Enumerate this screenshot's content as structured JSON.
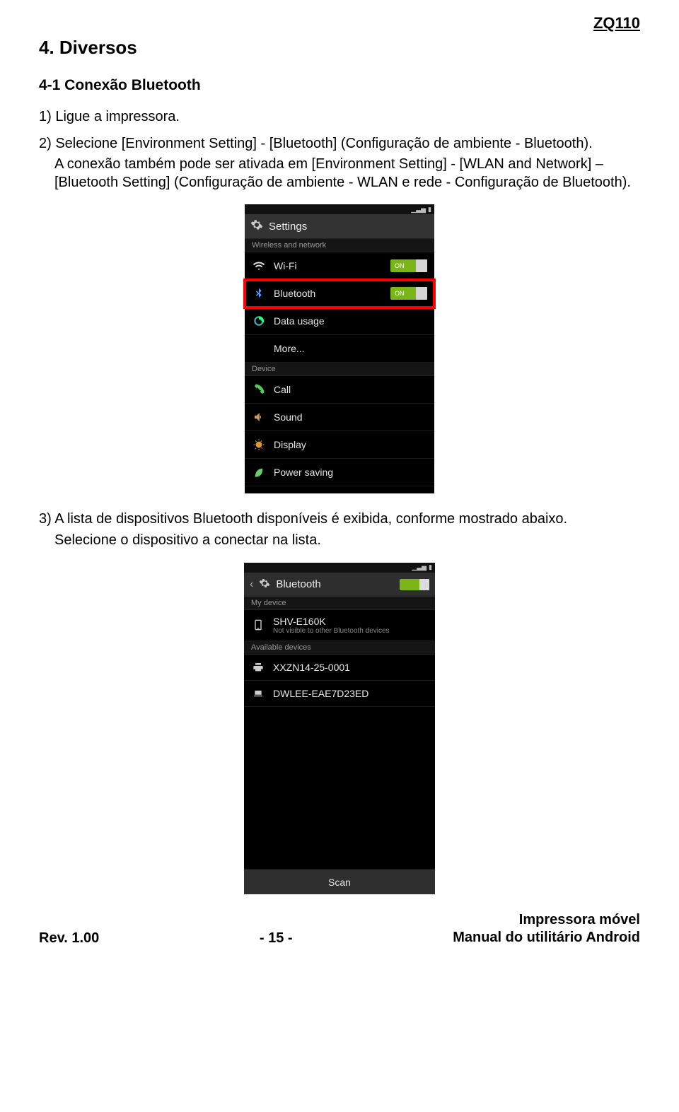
{
  "header_model": "ZQ110",
  "section_title": "4. Diversos",
  "sub_title": "4-1 Conexão Bluetooth",
  "step1": "1) Ligue a impressora.",
  "step2_line1": "2) Selecione [Environment Setting] - [Bluetooth] (Configuração de ambiente - Bluetooth).",
  "step2_line2": "A conexão também pode ser ativada em [Environment Setting] - [WLAN and Network] – [Bluetooth Setting] (Configuração de ambiente - WLAN e rede - Configuração de Bluetooth).",
  "step3_line1": "3) A lista de dispositivos Bluetooth disponíveis é exibida, conforme mostrado abaixo.",
  "step3_line2": "Selecione o dispositivo a conectar na lista.",
  "screenshot1": {
    "title": "Settings",
    "section_wireless": "Wireless and network",
    "items_wireless": [
      {
        "label": "Wi-Fi",
        "toggle": "ON"
      },
      {
        "label": "Bluetooth",
        "toggle": "ON"
      },
      {
        "label": "Data usage"
      },
      {
        "label": "More..."
      }
    ],
    "section_device": "Device",
    "items_device": [
      {
        "label": "Call"
      },
      {
        "label": "Sound"
      },
      {
        "label": "Display"
      },
      {
        "label": "Power saving"
      }
    ]
  },
  "screenshot2": {
    "title": "Bluetooth",
    "section_mydevice": "My device",
    "mydevice_name": "SHV-E160K",
    "mydevice_sub": "Not visible to other Bluetooth devices",
    "section_available": "Available devices",
    "available": [
      {
        "name": "XXZN14-25-0001",
        "icon": "printer"
      },
      {
        "name": "DWLEE-EAE7D23ED",
        "icon": "laptop"
      }
    ],
    "scan_label": "Scan"
  },
  "footer": {
    "rev": "Rev. 1.00",
    "page": "- 15 -",
    "doc_title_1": "Impressora móvel",
    "doc_title_2": "Manual do utilitário Android"
  }
}
